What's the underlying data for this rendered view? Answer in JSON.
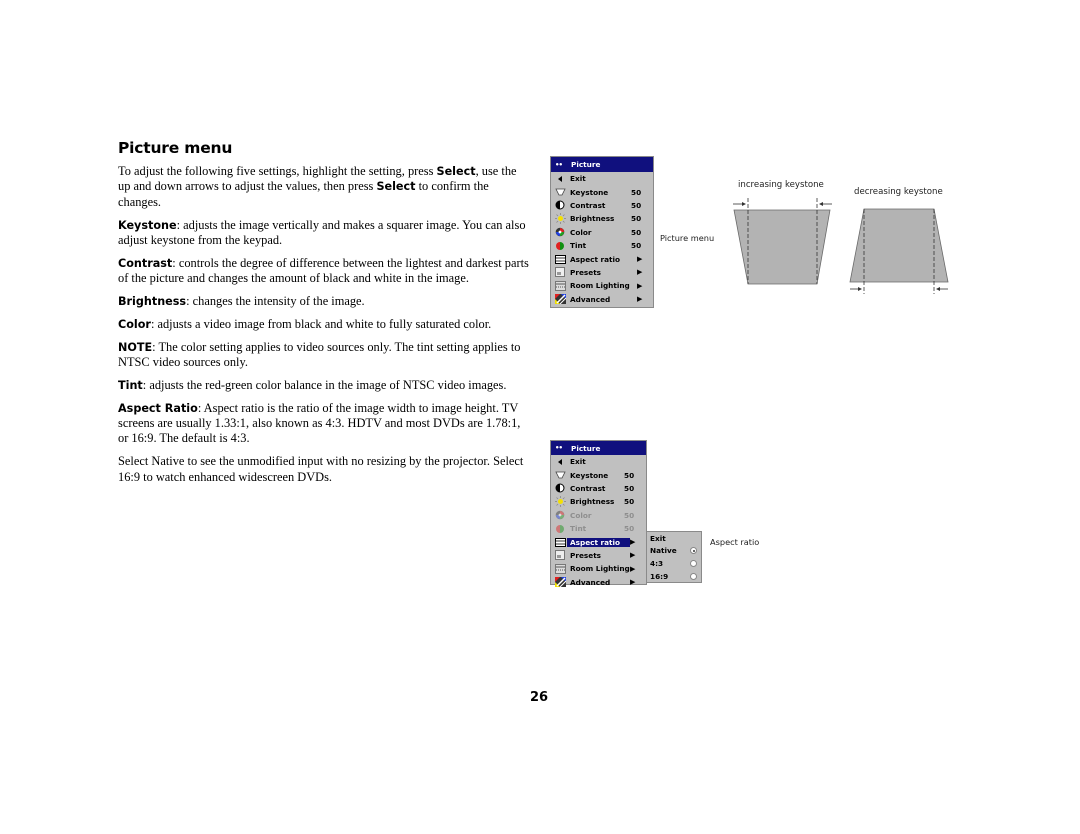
{
  "page": {
    "heading": "Picture menu",
    "page_number": "26"
  },
  "paragraphs": [
    {
      "parts": [
        {
          "text": "To adjust the following five settings, highlight the setting, press ",
          "bold": false
        },
        {
          "text": "Select",
          "bold": true
        },
        {
          "text": ", use the up and down arrows to adjust the values, then press ",
          "bold": false
        },
        {
          "text": "Select",
          "bold": true
        },
        {
          "text": " to confirm the changes.",
          "bold": false
        }
      ]
    },
    {
      "parts": [
        {
          "text": "Keystone",
          "bold": true
        },
        {
          "text": ": adjusts the image vertically and makes a squarer image. You can also adjust keystone from the keypad.",
          "bold": false
        }
      ]
    },
    {
      "parts": [
        {
          "text": "Contrast",
          "bold": true
        },
        {
          "text": ": controls the degree of difference between the lightest and darkest parts of the picture and changes the amount of black and white in the image.",
          "bold": false
        }
      ]
    },
    {
      "parts": [
        {
          "text": "Brightness",
          "bold": true
        },
        {
          "text": ": changes the intensity of the image.",
          "bold": false
        }
      ]
    },
    {
      "parts": [
        {
          "text": "Color",
          "bold": true
        },
        {
          "text": ": adjusts a video image from black and white to fully saturated color.",
          "bold": false
        }
      ]
    },
    {
      "parts": [
        {
          "text": "NOTE",
          "bold": true
        },
        {
          "text": ": The color setting applies to video sources only. The tint setting applies to NTSC video sources only.",
          "bold": false
        }
      ]
    },
    {
      "parts": [
        {
          "text": "Tint",
          "bold": true
        },
        {
          "text": ": adjusts the red-green color balance in the image of NTSC video images.",
          "bold": false
        }
      ]
    },
    {
      "parts": [
        {
          "text": "Aspect Ratio",
          "bold": true
        },
        {
          "text": ": Aspect ratio is the ratio of the image width to image height. TV screens are usually 1.33:1, also known as 4:3. HDTV and most DVDs are 1.78:1, or 16:9. The default is 4:3.",
          "bold": false
        }
      ]
    },
    {
      "parts": [
        {
          "text": "Select Native to see the unmodified input with no resizing by the projector. Select 16:9 to watch enhanced widescreen DVDs.",
          "bold": false
        }
      ]
    }
  ],
  "menu1": {
    "title": "Picture",
    "caption": "Picture menu",
    "items": [
      {
        "label": "Exit",
        "icon": "exit-arrow-icon",
        "value": "",
        "arrow": false,
        "dim": false
      },
      {
        "label": "Keystone",
        "icon": "keystone-icon",
        "value": "50",
        "arrow": false,
        "dim": false
      },
      {
        "label": "Contrast",
        "icon": "contrast-icon",
        "value": "50",
        "arrow": false,
        "dim": false
      },
      {
        "label": "Brightness",
        "icon": "brightness-icon",
        "value": "50",
        "arrow": false,
        "dim": false
      },
      {
        "label": "Color",
        "icon": "color-icon",
        "value": "50",
        "arrow": false,
        "dim": false
      },
      {
        "label": "Tint",
        "icon": "tint-icon",
        "value": "50",
        "arrow": false,
        "dim": false
      },
      {
        "label": "Aspect ratio",
        "icon": "aspect-ratio-icon",
        "value": "",
        "arrow": true,
        "dim": false
      },
      {
        "label": "Presets",
        "icon": "presets-icon",
        "value": "",
        "arrow": true,
        "dim": false
      },
      {
        "label": "Room Lighting",
        "icon": "room-lighting-icon",
        "value": "",
        "arrow": true,
        "dim": false
      },
      {
        "label": "Advanced",
        "icon": "advanced-icon",
        "value": "",
        "arrow": true,
        "dim": false
      }
    ]
  },
  "menu2": {
    "title": "Picture",
    "caption": "Aspect ratio",
    "selected": "Aspect ratio",
    "items": [
      {
        "label": "Exit",
        "icon": "exit-arrow-icon",
        "value": "",
        "arrow": false,
        "dim": false
      },
      {
        "label": "Keystone",
        "icon": "keystone-icon",
        "value": "50",
        "arrow": false,
        "dim": false
      },
      {
        "label": "Contrast",
        "icon": "contrast-icon",
        "value": "50",
        "arrow": false,
        "dim": false
      },
      {
        "label": "Brightness",
        "icon": "brightness-icon",
        "value": "50",
        "arrow": false,
        "dim": false
      },
      {
        "label": "Color",
        "icon": "color-icon",
        "value": "50",
        "arrow": false,
        "dim": true
      },
      {
        "label": "Tint",
        "icon": "tint-icon",
        "value": "50",
        "arrow": false,
        "dim": true
      },
      {
        "label": "Aspect ratio",
        "icon": "aspect-ratio-icon",
        "value": "",
        "arrow": true,
        "dim": false
      },
      {
        "label": "Presets",
        "icon": "presets-icon",
        "value": "",
        "arrow": true,
        "dim": false
      },
      {
        "label": "Room Lighting",
        "icon": "room-lighting-icon",
        "value": "",
        "arrow": true,
        "dim": false
      },
      {
        "label": "Advanced",
        "icon": "advanced-icon",
        "value": "",
        "arrow": true,
        "dim": false
      }
    ],
    "submenu": [
      {
        "label": "Exit",
        "radio": false,
        "checked": false
      },
      {
        "label": "Native",
        "radio": true,
        "checked": true
      },
      {
        "label": "4:3",
        "radio": true,
        "checked": false
      },
      {
        "label": "16:9",
        "radio": true,
        "checked": false
      }
    ]
  },
  "keystone": {
    "increasing_label": "increasing keystone",
    "decreasing_label": "decreasing keystone",
    "shape_color": "#b3b3b3"
  },
  "colors": {
    "menu_title_bg": "#10107e",
    "menu_bg": "#c0c0c0",
    "dim_text": "#8e8e8e"
  }
}
